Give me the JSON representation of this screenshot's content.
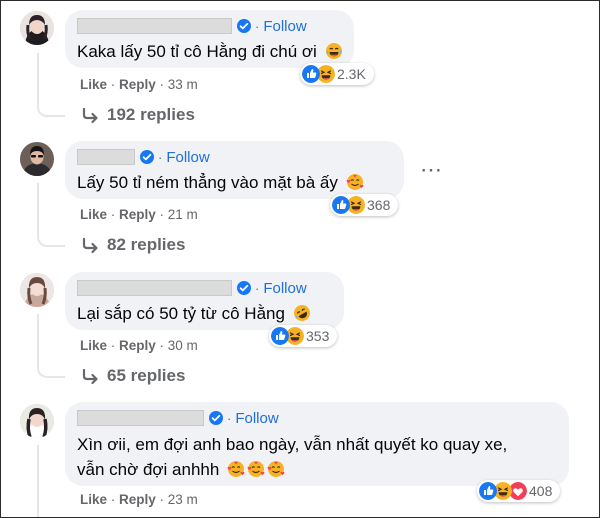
{
  "comments": [
    {
      "follow": "Follow",
      "text": "Kaka lấy 50 tỉ cô Hằng đi chú ơi",
      "like": "Like",
      "reply": "Reply",
      "time": "33 m",
      "reaction_count": "2.3K",
      "replies": "192 replies"
    },
    {
      "follow": "Follow",
      "text": "Lấy 50 tỉ ném thẳng vào mặt bà ấy",
      "like": "Like",
      "reply": "Reply",
      "time": "21 m",
      "reaction_count": "368",
      "replies": "82 replies"
    },
    {
      "follow": "Follow",
      "text": "Lại sắp có 50 tỷ từ cô Hằng",
      "like": "Like",
      "reply": "Reply",
      "time": "30 m",
      "reaction_count": "353",
      "replies": "65 replies"
    },
    {
      "follow": "Follow",
      "text_line1": "Xìn ơii, em đợi anh bao ngày, vẫn nhất quyết ko quay xe,",
      "text_line2": "vẫn chờ đợi anhhh",
      "like": "Like",
      "reply": "Reply",
      "time": "23 m",
      "reaction_count": "408"
    }
  ],
  "more_icon": "⋯",
  "colors": {
    "link": "#216fdb",
    "bubble": "#f0f2f5",
    "meta": "#65676b",
    "like_blue": "#1877f2",
    "haha_yellow": "#f7b125",
    "love_red": "#f33e58"
  },
  "icons": [
    "verified-badge-icon",
    "reply-arrow-icon",
    "like-reaction-icon",
    "haha-reaction-icon",
    "love-reaction-icon",
    "smiling-hearts-emoji",
    "tears-of-joy-emoji",
    "rofl-emoji",
    "more-options-icon"
  ]
}
